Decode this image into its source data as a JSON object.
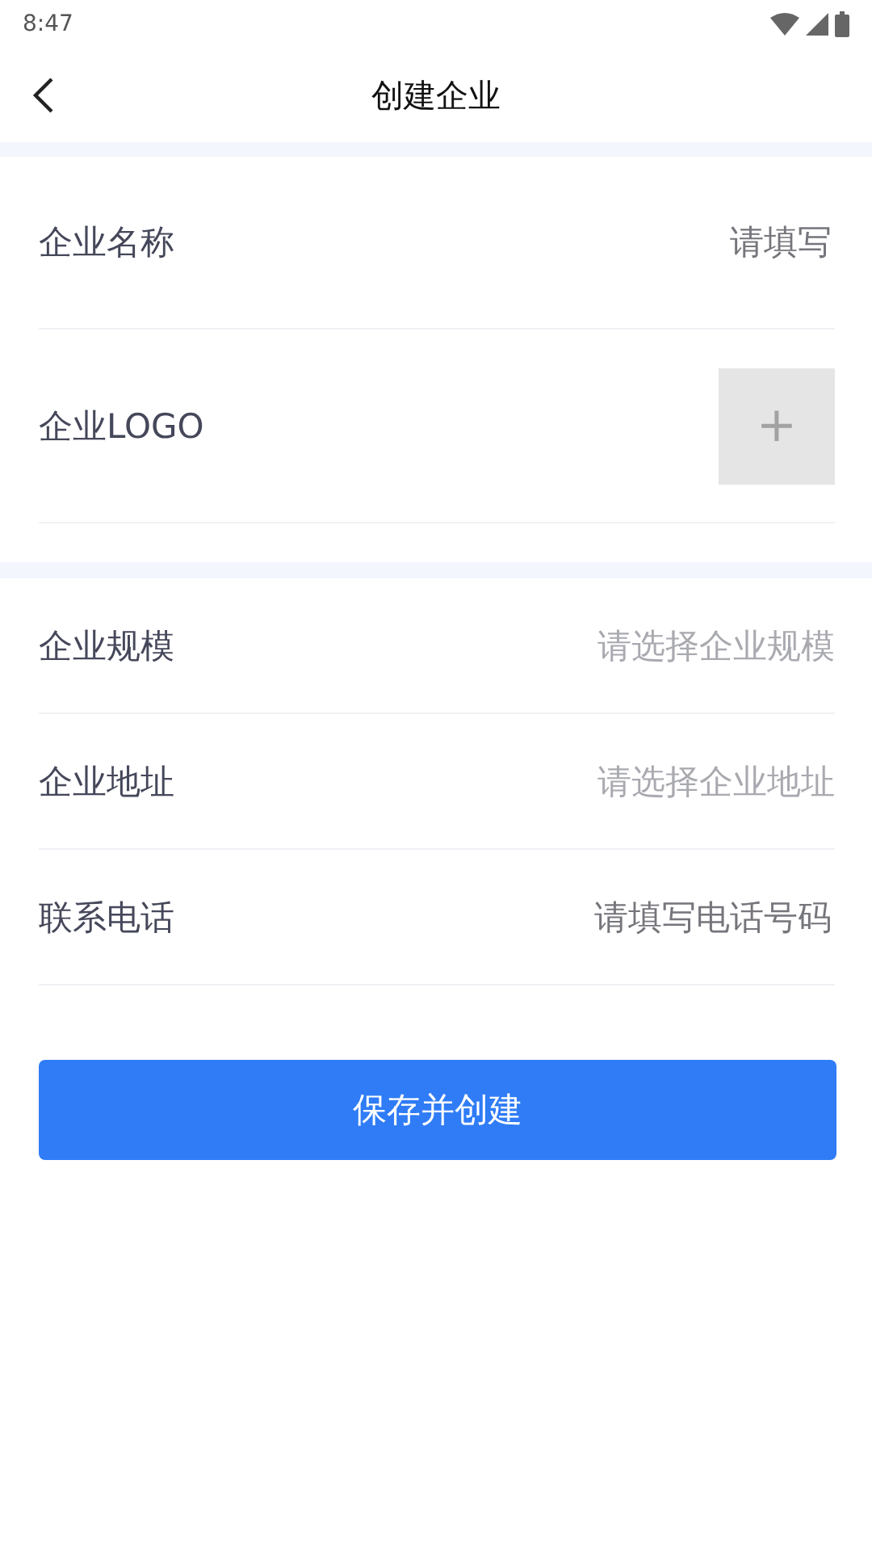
{
  "status_bar": {
    "time": "8:47"
  },
  "header": {
    "title": "创建企业"
  },
  "sections": [
    {
      "rows": [
        {
          "kind": "input",
          "label": "企业名称",
          "placeholder": "请填写"
        },
        {
          "kind": "upload",
          "label": "企业LOGO",
          "symbol": "+"
        }
      ]
    },
    {
      "rows": [
        {
          "kind": "select",
          "label": "企业规模",
          "hint": "请选择企业规模"
        },
        {
          "kind": "select",
          "label": "企业地址",
          "hint": "请选择企业地址"
        },
        {
          "kind": "input",
          "label": "联系电话",
          "placeholder": "请填写电话号码"
        }
      ]
    }
  ],
  "submit": {
    "label": "保存并创建"
  }
}
